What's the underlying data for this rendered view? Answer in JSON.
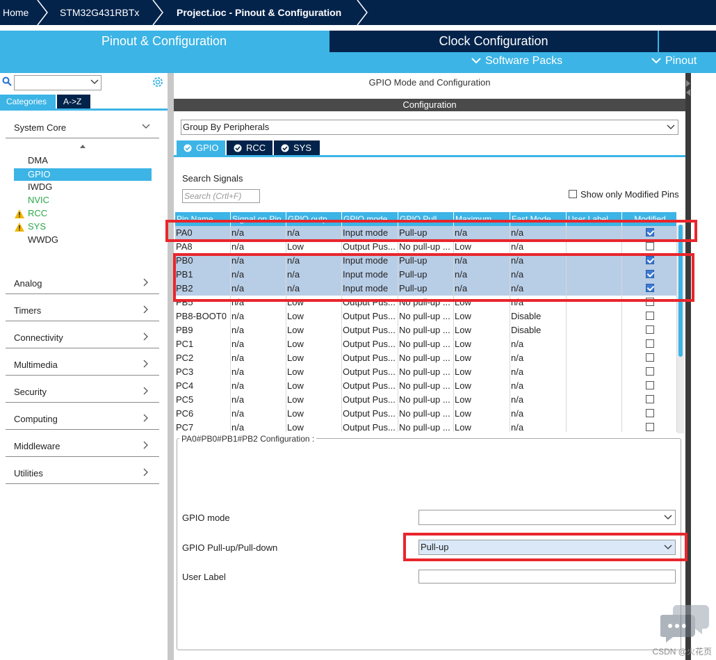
{
  "breadcrumb": {
    "home": "Home",
    "chip": "STM32G431RBTx",
    "project": "Project.ioc - Pinout & Configuration"
  },
  "tabs": {
    "pinout": "Pinout & Configuration",
    "clock": "Clock Configuration",
    "software_packs": "Software Packs",
    "pinout_menu": "Pinout"
  },
  "sidebar": {
    "search_placeholder": "",
    "cat_tab": "Categories",
    "az_tab": "A->Z",
    "system_core": "System Core",
    "system_core_items": [
      {
        "label": "DMA",
        "style": "normal"
      },
      {
        "label": "GPIO",
        "style": "selected"
      },
      {
        "label": "IWDG",
        "style": "normal"
      },
      {
        "label": "NVIC",
        "style": "green"
      },
      {
        "label": "RCC",
        "style": "warn"
      },
      {
        "label": "SYS",
        "style": "warn"
      },
      {
        "label": "WWDG",
        "style": "normal"
      }
    ],
    "groups": [
      "Analog",
      "Timers",
      "Connectivity",
      "Multimedia",
      "Security",
      "Computing",
      "Middleware",
      "Utilities"
    ]
  },
  "panel": {
    "title": "GPIO Mode and Configuration",
    "config_bar": "Configuration",
    "group_by": "Group By Peripherals",
    "periph_tabs": [
      "GPIO",
      "RCC",
      "SYS"
    ],
    "search_label": "Search Signals",
    "search_placeholder": "Search (Crtl+F)",
    "show_modified": "Show only Modified Pins"
  },
  "table": {
    "headers": [
      "Pin Name",
      "Signal on Pin",
      "GPIO outp...",
      "GPIO mode",
      "GPIO Pull...",
      "Maximum ...",
      "Fast Mode",
      "User Label",
      "Modified"
    ],
    "rows": [
      {
        "pin": "PA0",
        "signal": "n/a",
        "output": "n/a",
        "mode": "Input mode",
        "pull": "Pull-up",
        "max": "n/a",
        "fast": "n/a",
        "label": "",
        "modified": true,
        "selected": true
      },
      {
        "pin": "PA8",
        "signal": "n/a",
        "output": "Low",
        "mode": "Output Pus...",
        "pull": "No pull-up ...",
        "max": "Low",
        "fast": "n/a",
        "label": "",
        "modified": false,
        "selected": false
      },
      {
        "pin": "PB0",
        "signal": "n/a",
        "output": "n/a",
        "mode": "Input mode",
        "pull": "Pull-up",
        "max": "n/a",
        "fast": "n/a",
        "label": "",
        "modified": true,
        "selected": true
      },
      {
        "pin": "PB1",
        "signal": "n/a",
        "output": "n/a",
        "mode": "Input mode",
        "pull": "Pull-up",
        "max": "n/a",
        "fast": "n/a",
        "label": "",
        "modified": true,
        "selected": true
      },
      {
        "pin": "PB2",
        "signal": "n/a",
        "output": "n/a",
        "mode": "Input mode",
        "pull": "Pull-up",
        "max": "n/a",
        "fast": "n/a",
        "label": "",
        "modified": true,
        "selected": true
      },
      {
        "pin": "PB5",
        "signal": "n/a",
        "output": "Low",
        "mode": "Output Pus...",
        "pull": "No pull-up ...",
        "max": "Low",
        "fast": "n/a",
        "label": "",
        "modified": false,
        "selected": false
      },
      {
        "pin": "PB8-BOOT0",
        "signal": "n/a",
        "output": "Low",
        "mode": "Output Pus...",
        "pull": "No pull-up ...",
        "max": "Low",
        "fast": "Disable",
        "label": "",
        "modified": false,
        "selected": false
      },
      {
        "pin": "PB9",
        "signal": "n/a",
        "output": "Low",
        "mode": "Output Pus...",
        "pull": "No pull-up ...",
        "max": "Low",
        "fast": "Disable",
        "label": "",
        "modified": false,
        "selected": false
      },
      {
        "pin": "PC1",
        "signal": "n/a",
        "output": "Low",
        "mode": "Output Pus...",
        "pull": "No pull-up ...",
        "max": "Low",
        "fast": "n/a",
        "label": "",
        "modified": false,
        "selected": false
      },
      {
        "pin": "PC2",
        "signal": "n/a",
        "output": "Low",
        "mode": "Output Pus...",
        "pull": "No pull-up ...",
        "max": "Low",
        "fast": "n/a",
        "label": "",
        "modified": false,
        "selected": false
      },
      {
        "pin": "PC3",
        "signal": "n/a",
        "output": "Low",
        "mode": "Output Pus...",
        "pull": "No pull-up ...",
        "max": "Low",
        "fast": "n/a",
        "label": "",
        "modified": false,
        "selected": false
      },
      {
        "pin": "PC4",
        "signal": "n/a",
        "output": "Low",
        "mode": "Output Pus...",
        "pull": "No pull-up ...",
        "max": "Low",
        "fast": "n/a",
        "label": "",
        "modified": false,
        "selected": false
      },
      {
        "pin": "PC5",
        "signal": "n/a",
        "output": "Low",
        "mode": "Output Pus...",
        "pull": "No pull-up ...",
        "max": "Low",
        "fast": "n/a",
        "label": "",
        "modified": false,
        "selected": false
      },
      {
        "pin": "PC6",
        "signal": "n/a",
        "output": "Low",
        "mode": "Output Pus...",
        "pull": "No pull-up ...",
        "max": "Low",
        "fast": "n/a",
        "label": "",
        "modified": false,
        "selected": false
      },
      {
        "pin": "PC7",
        "signal": "n/a",
        "output": "Low",
        "mode": "Output Pus...",
        "pull": "No pull-up ...",
        "max": "Low",
        "fast": "n/a",
        "label": "",
        "modified": false,
        "selected": false
      }
    ]
  },
  "config": {
    "legend": "PA0#PB0#PB1#PB2 Configuration :",
    "gpio_mode_label": "GPIO mode",
    "gpio_mode_value": "",
    "pull_label": "GPIO Pull-up/Pull-down",
    "pull_value": "Pull-up",
    "user_label_label": "User Label",
    "user_label_value": ""
  },
  "watermark": "CSDN @火花页",
  "colors": {
    "navy": "#03234b",
    "accent": "#3cb4e6",
    "highlight": "#e8262c",
    "selected_row": "#b8cde6"
  }
}
